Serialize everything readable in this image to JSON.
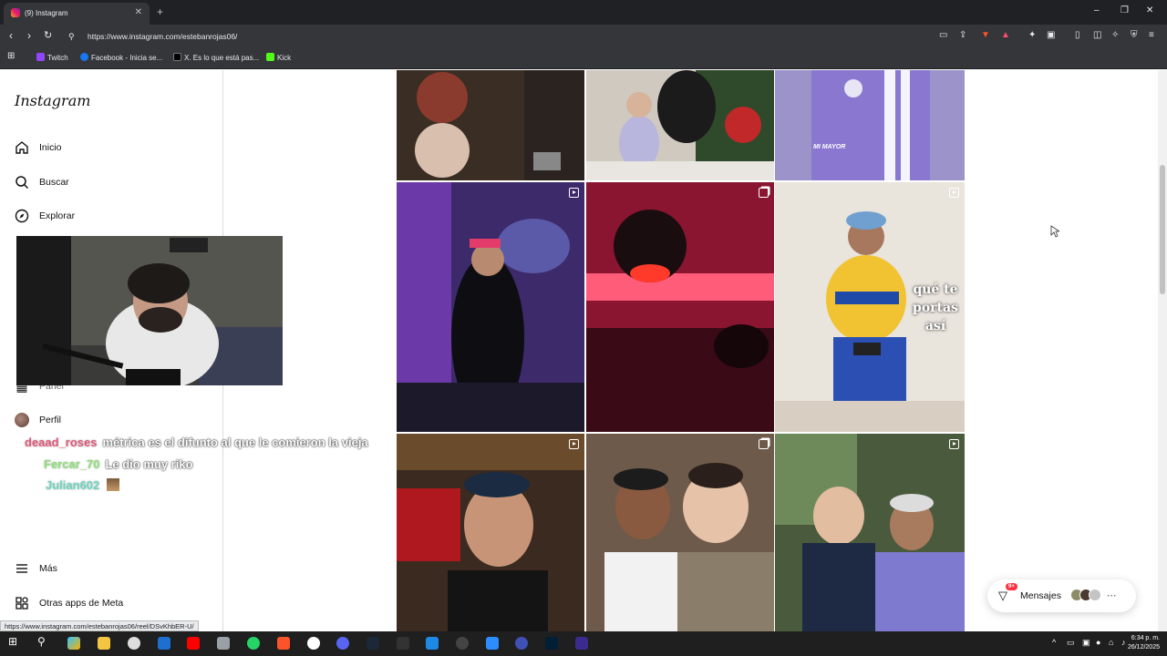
{
  "browser": {
    "tab_title": "(9) Instagram",
    "tab_close": "✕",
    "new_tab": "+",
    "url": "https://www.instagram.com/estebanrojas06/",
    "status_url": "https://www.instagram.com/estebanrojas06/reel/DSvKhbER-U/",
    "bookmarks": [
      {
        "label": "Twitch",
        "color": "#9146ff"
      },
      {
        "label": "Facebook - Inicia se...",
        "color": "#1877f2"
      },
      {
        "label": "X. Es lo que está pas...",
        "color": "#000000"
      },
      {
        "label": "Kick",
        "color": "#53fc18"
      }
    ]
  },
  "sidebar": {
    "logo": "Instagram",
    "items": [
      {
        "label": "Inicio",
        "icon": "home-icon"
      },
      {
        "label": "Buscar",
        "icon": "search-icon"
      },
      {
        "label": "Explorar",
        "icon": "compass-icon"
      },
      {
        "label": "Panel",
        "icon": "dashboard-icon"
      },
      {
        "label": "Perfil",
        "icon": "avatar"
      },
      {
        "label": "Más",
        "icon": "menu-icon"
      },
      {
        "label": "Otras apps de Meta",
        "icon": "meta-apps-icon"
      }
    ]
  },
  "chat": [
    {
      "user": "deaad_roses",
      "color": "#e05a7a",
      "message": "métrica es el difunto al que le comieron la vieja"
    },
    {
      "user": "Fercar_70",
      "color": "#8fe07a",
      "message": "Le dio muy riko"
    },
    {
      "user": "Julian602",
      "color": "#6fd6c0",
      "message": ""
    }
  ],
  "grid": {
    "posts": [
      {
        "caption": "",
        "badge": "none"
      },
      {
        "caption": "",
        "badge": "none"
      },
      {
        "caption": "MI MAYOR",
        "badge": "none"
      },
      {
        "caption": "",
        "badge": "reel"
      },
      {
        "caption": "",
        "badge": "multi"
      },
      {
        "caption": "qué te portas así",
        "badge": "reel"
      },
      {
        "caption": "",
        "badge": "reel"
      },
      {
        "caption": "",
        "badge": "multi"
      },
      {
        "caption": "",
        "badge": "reel"
      }
    ]
  },
  "messages": {
    "label": "Mensajes",
    "badge": "9+"
  },
  "taskbar": {
    "time": "6:34 p. m.",
    "date": "26/12/2025"
  }
}
